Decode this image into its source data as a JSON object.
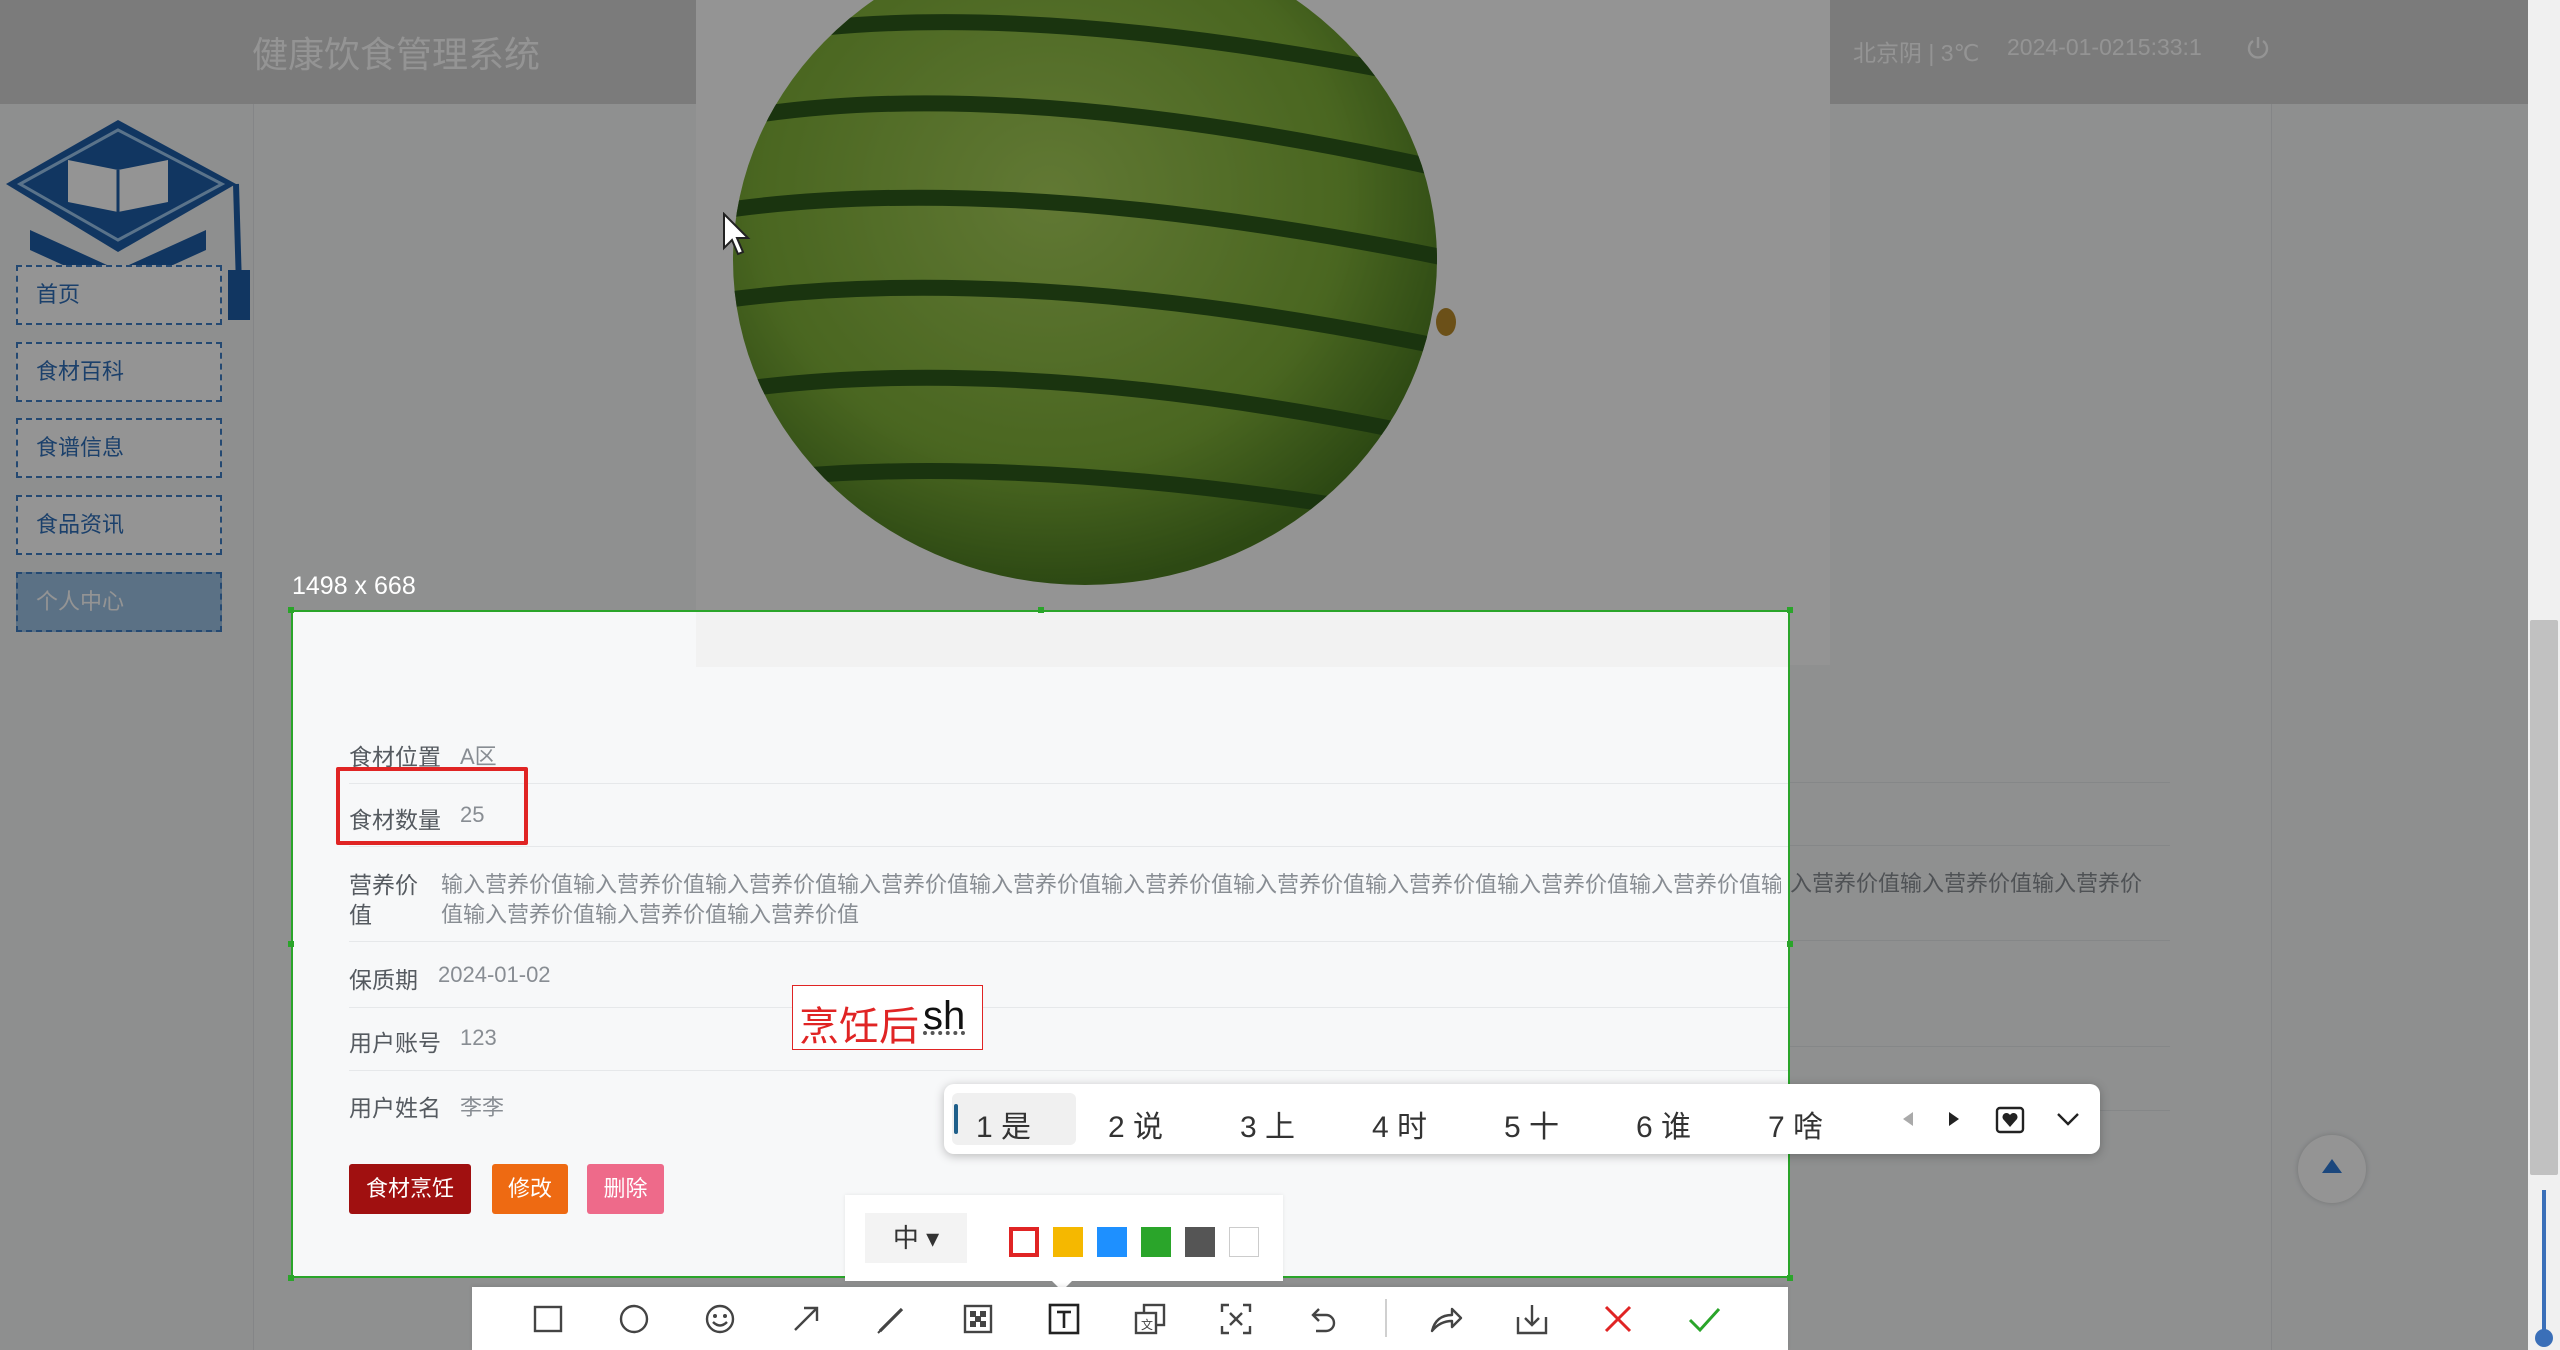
{
  "header": {
    "title": "健康饮食管理系统",
    "weather": "北京阴 | 3℃",
    "date": "2024-01-02",
    "time": "15:33:1"
  },
  "nav": {
    "items": [
      {
        "label": "首页"
      },
      {
        "label": "食材百科"
      },
      {
        "label": "食谱信息"
      },
      {
        "label": "食品资讯"
      },
      {
        "label": "个人中心"
      }
    ]
  },
  "detail": {
    "location_label": "食材位置",
    "location_value": "A区",
    "quantity_label": "食材数量",
    "quantity_value": "25",
    "nutrition_label_1": "营养价",
    "nutrition_label_2": "值",
    "nutrition_value_1": "输入营养价值输入营养价值输入营养价值输入营养价值输入营养价值输入营养价值输入营养价值输入营养价值输入营养价值输入营养价值输入营养价值输入营养价值输入营养价",
    "nutrition_value_2": "值输入营养价值输入营养价值输入营养价值",
    "expiry_label": "保质期",
    "expiry_value": "2024-01-02",
    "account_label": "用户账号",
    "account_value": "123",
    "username_label": "用户姓名",
    "username_value": "李李"
  },
  "actions": {
    "cook_label": "食材烹饪",
    "edit_label": "修改",
    "delete_label": "删除"
  },
  "screenshot_tool": {
    "size_label": "1498 x 668",
    "text_annotation_zh": "烹饪后",
    "text_annotation_latin": "sh",
    "font_size_label": "中",
    "colors": [
      "#e02424",
      "#f5b800",
      "#1e90ff",
      "#2aa52a",
      "#555555",
      "#ffffff"
    ],
    "selected_color": "#e02424",
    "tools": [
      "rectangle-icon",
      "ellipse-icon",
      "emoji-icon",
      "arrow-icon",
      "pen-icon",
      "mosaic-icon",
      "text-icon",
      "pin-icon",
      "ocr-icon",
      "undo-icon",
      "share-icon",
      "save-icon",
      "cancel-icon",
      "confirm-icon"
    ]
  },
  "ime": {
    "candidates": [
      {
        "index": "1",
        "text": "是"
      },
      {
        "index": "2",
        "text": "说"
      },
      {
        "index": "3",
        "text": "上"
      },
      {
        "index": "4",
        "text": "时"
      },
      {
        "index": "5",
        "text": "十"
      },
      {
        "index": "6",
        "text": "谁"
      },
      {
        "index": "7",
        "text": "啥"
      }
    ]
  }
}
